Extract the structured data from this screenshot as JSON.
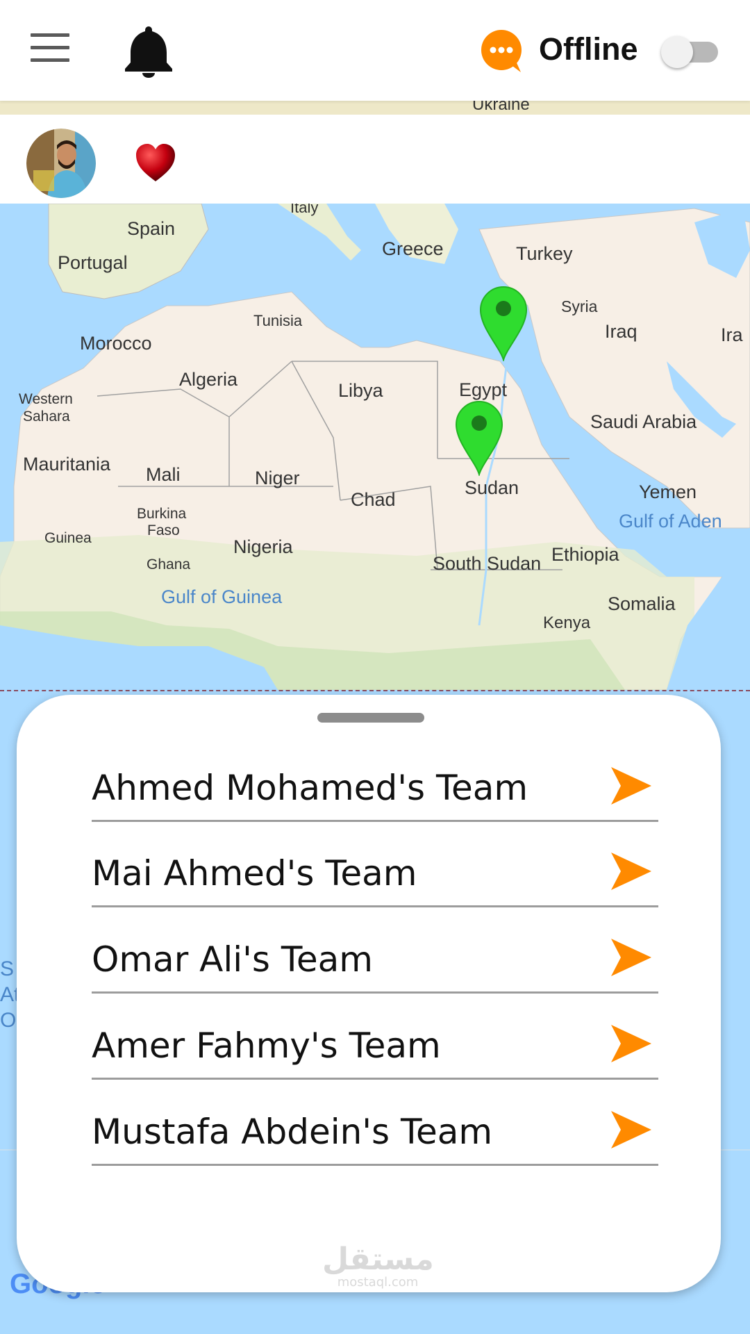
{
  "header": {
    "menu_icon": "hamburger-menu-icon",
    "bell_icon": "notification-bell-icon",
    "chat_icon": "chat-bubble-icon",
    "status_label": "Offline",
    "toggle_on": false,
    "accent_color": "#ff8a00"
  },
  "profile": {
    "avatar_icon": "user-avatar",
    "heart_icon": "heart-icon",
    "heart_color": "#c4000f"
  },
  "map": {
    "marker_color": "#2fdc2f",
    "labels": {
      "ukraine": "Ukraine",
      "italy": "Italy",
      "spain": "Spain",
      "portugal": "Portugal",
      "greece": "Greece",
      "turkey": "Turkey",
      "syria": "Syria",
      "iraq": "Iraq",
      "iran": "Ira",
      "tunisia": "Tunisia",
      "morocco": "Morocco",
      "algeria": "Algeria",
      "libya": "Libya",
      "egypt": "Egypt",
      "western_sahara_1": "Western",
      "western_sahara_2": "Sahara",
      "saudi_arabia": "Saudi Arabia",
      "mauritania": "Mauritania",
      "mali": "Mali",
      "niger": "Niger",
      "chad": "Chad",
      "sudan": "Sudan",
      "yemen": "Yemen",
      "gulf_of_aden": "Gulf of Aden",
      "burkina_1": "Burkina",
      "burkina_2": "Faso",
      "guinea": "Guinea",
      "nigeria": "Nigeria",
      "ghana": "Ghana",
      "south_sudan": "South Sudan",
      "ethiopia": "Ethiopia",
      "gulf_of_guinea": "Gulf of Guinea",
      "somalia": "Somalia",
      "kenya": "Kenya",
      "atlantic_1": "S",
      "atlantic_2": "At",
      "atlantic_3": "Oc"
    },
    "attribution": "Google"
  },
  "sheet": {
    "teams": [
      {
        "name": "Ahmed Mohamed's Team"
      },
      {
        "name": "Mai Ahmed's Team"
      },
      {
        "name": "Omar Ali's Team"
      },
      {
        "name": "Amer Fahmy's Team"
      },
      {
        "name": "Mustafa Abdein's Team"
      }
    ],
    "arrow_icon": "arrow-right-icon",
    "watermark_ar": "مستقل",
    "watermark_en": "mostaql.com"
  }
}
